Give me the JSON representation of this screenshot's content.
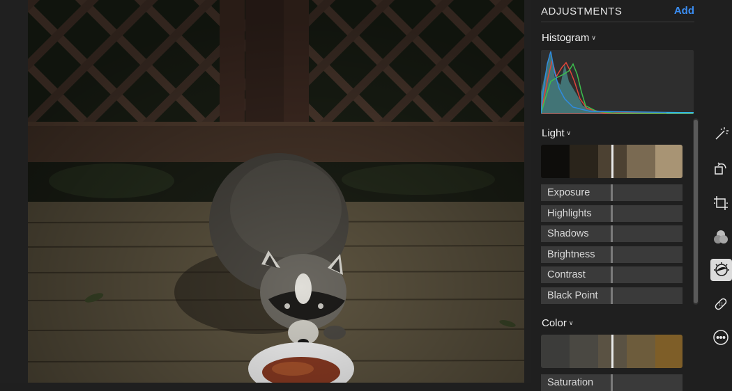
{
  "adjustments": {
    "title": "ADJUSTMENTS",
    "add_label": "Add"
  },
  "histogram": {
    "title": "Histogram"
  },
  "light": {
    "title": "Light",
    "rows": [
      "Exposure",
      "Highlights",
      "Shadows",
      "Brightness",
      "Contrast",
      "Black Point"
    ]
  },
  "color": {
    "title": "Color",
    "rows": [
      "Saturation"
    ]
  },
  "toolbar": {
    "tools": [
      "magic-wand-icon",
      "rotate-icon",
      "crop-icon",
      "filters-icon",
      "adjust-icon",
      "retouch-icon",
      "more-icon"
    ],
    "active": "adjust-icon"
  },
  "colors": {
    "accent": "#3b8df2",
    "panel": "#1f1f1f",
    "row": "#3a3a3a"
  }
}
